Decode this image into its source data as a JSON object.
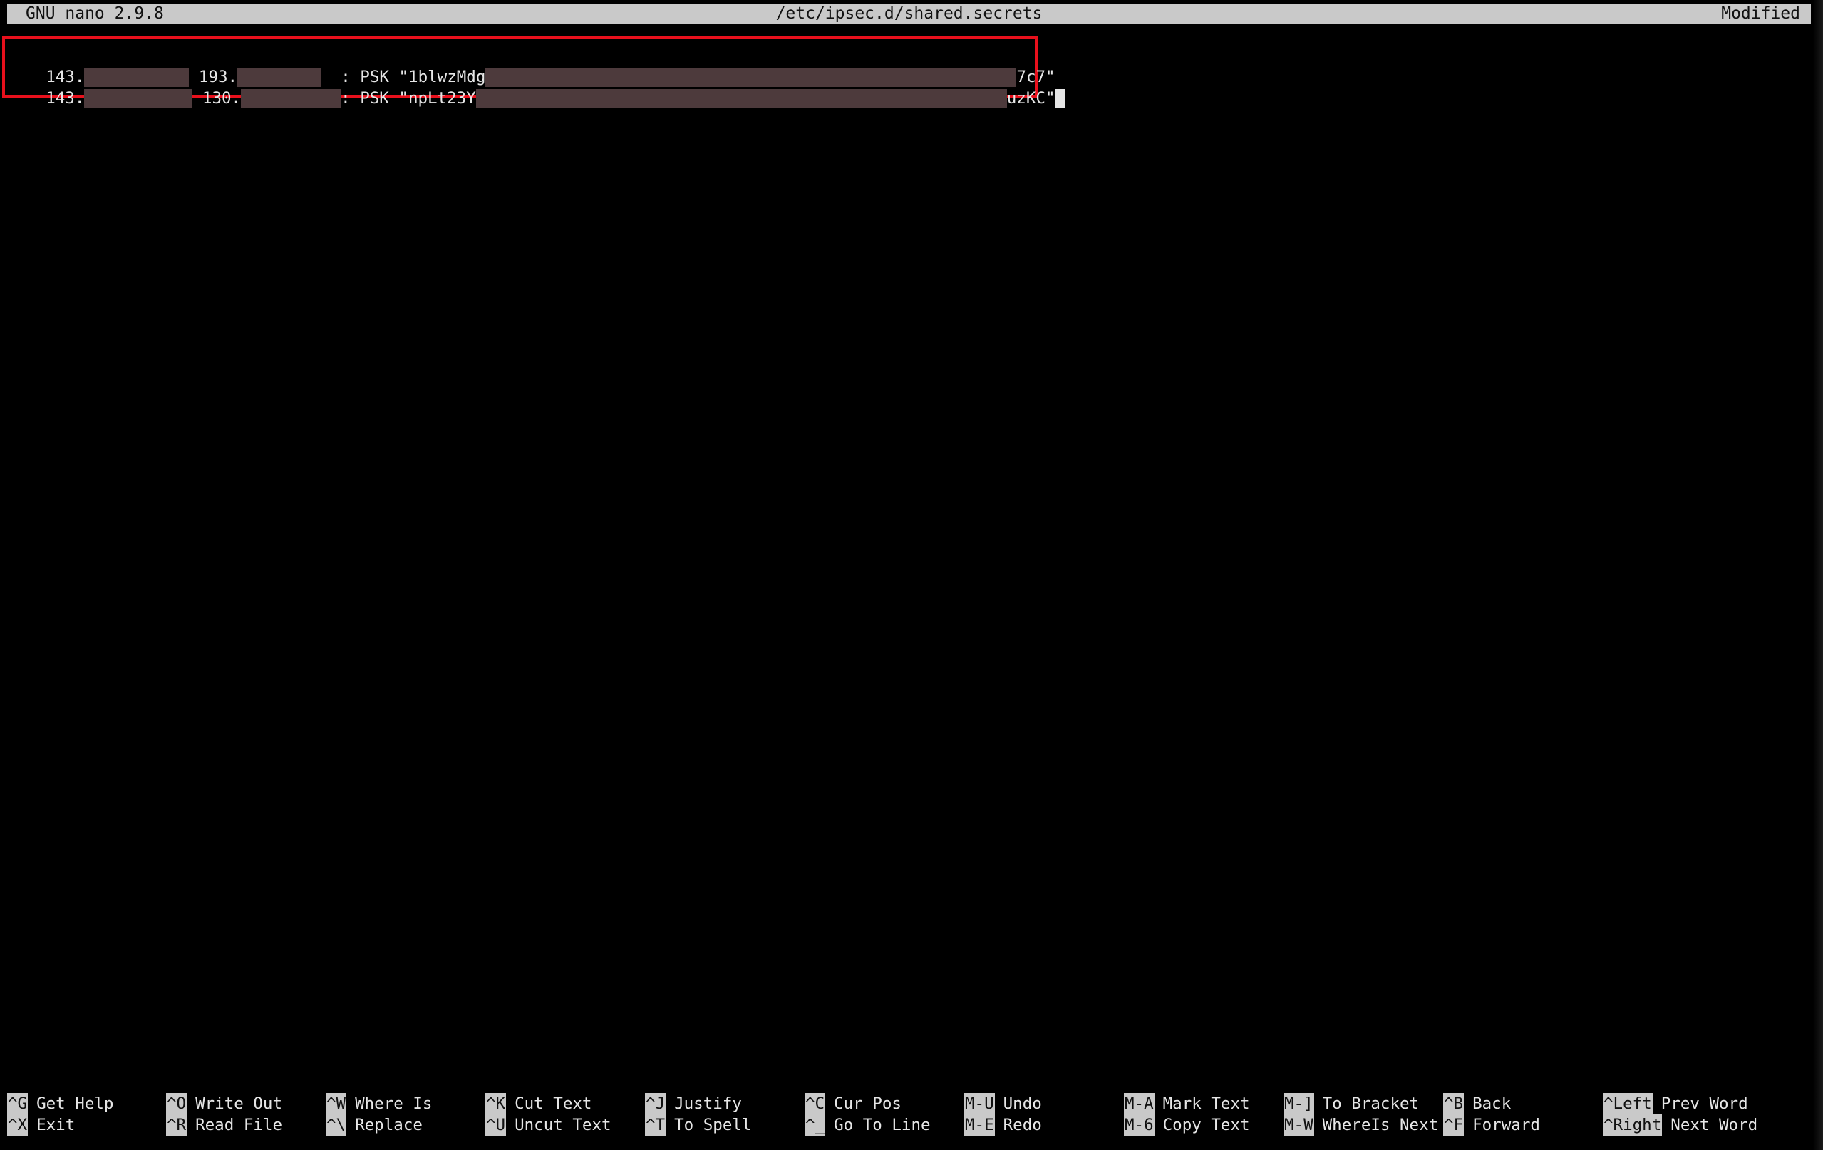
{
  "titlebar": {
    "version": "GNU nano 2.9.8",
    "filename": "/etc/ipsec.d/shared.secrets",
    "status": "Modified"
  },
  "content": {
    "lines": [
      {
        "ip1_prefix": "143.",
        "ip2_prefix": "193.",
        "sep": ": PSK \"",
        "psk_start": "1blwzMdg",
        "psk_end": "7c7\""
      },
      {
        "ip1_prefix": "143.",
        "ip2_prefix": "130.",
        "sep": ": PSK \"",
        "psk_start": "npLt23Y",
        "psk_end": "uzKC\""
      }
    ],
    "redaction_color": "#4d3a3c",
    "highlight_color": "#e8101c"
  },
  "shortcuts": [
    {
      "key": "^G",
      "label": "Get Help"
    },
    {
      "key": "^X",
      "label": "Exit"
    },
    {
      "key": "^O",
      "label": "Write Out"
    },
    {
      "key": "^R",
      "label": "Read File"
    },
    {
      "key": "^W",
      "label": "Where Is"
    },
    {
      "key": "^\\",
      "label": "Replace"
    },
    {
      "key": "^K",
      "label": "Cut Text"
    },
    {
      "key": "^U",
      "label": "Uncut Text"
    },
    {
      "key": "^J",
      "label": "Justify"
    },
    {
      "key": "^T",
      "label": "To Spell"
    },
    {
      "key": "^C",
      "label": "Cur Pos"
    },
    {
      "key": "^_",
      "label": "Go To Line"
    },
    {
      "key": "M-U",
      "label": "Undo"
    },
    {
      "key": "M-E",
      "label": "Redo"
    },
    {
      "key": "M-A",
      "label": "Mark Text"
    },
    {
      "key": "M-6",
      "label": "Copy Text"
    },
    {
      "key": "M-]",
      "label": "To Bracket"
    },
    {
      "key": "M-W",
      "label": "WhereIs Next"
    },
    {
      "key": "^B",
      "label": "Back"
    },
    {
      "key": "^F",
      "label": "Forward"
    },
    {
      "key": "^Left",
      "label": "Prev Word"
    },
    {
      "key": "^Right",
      "label": "Next Word"
    }
  ]
}
